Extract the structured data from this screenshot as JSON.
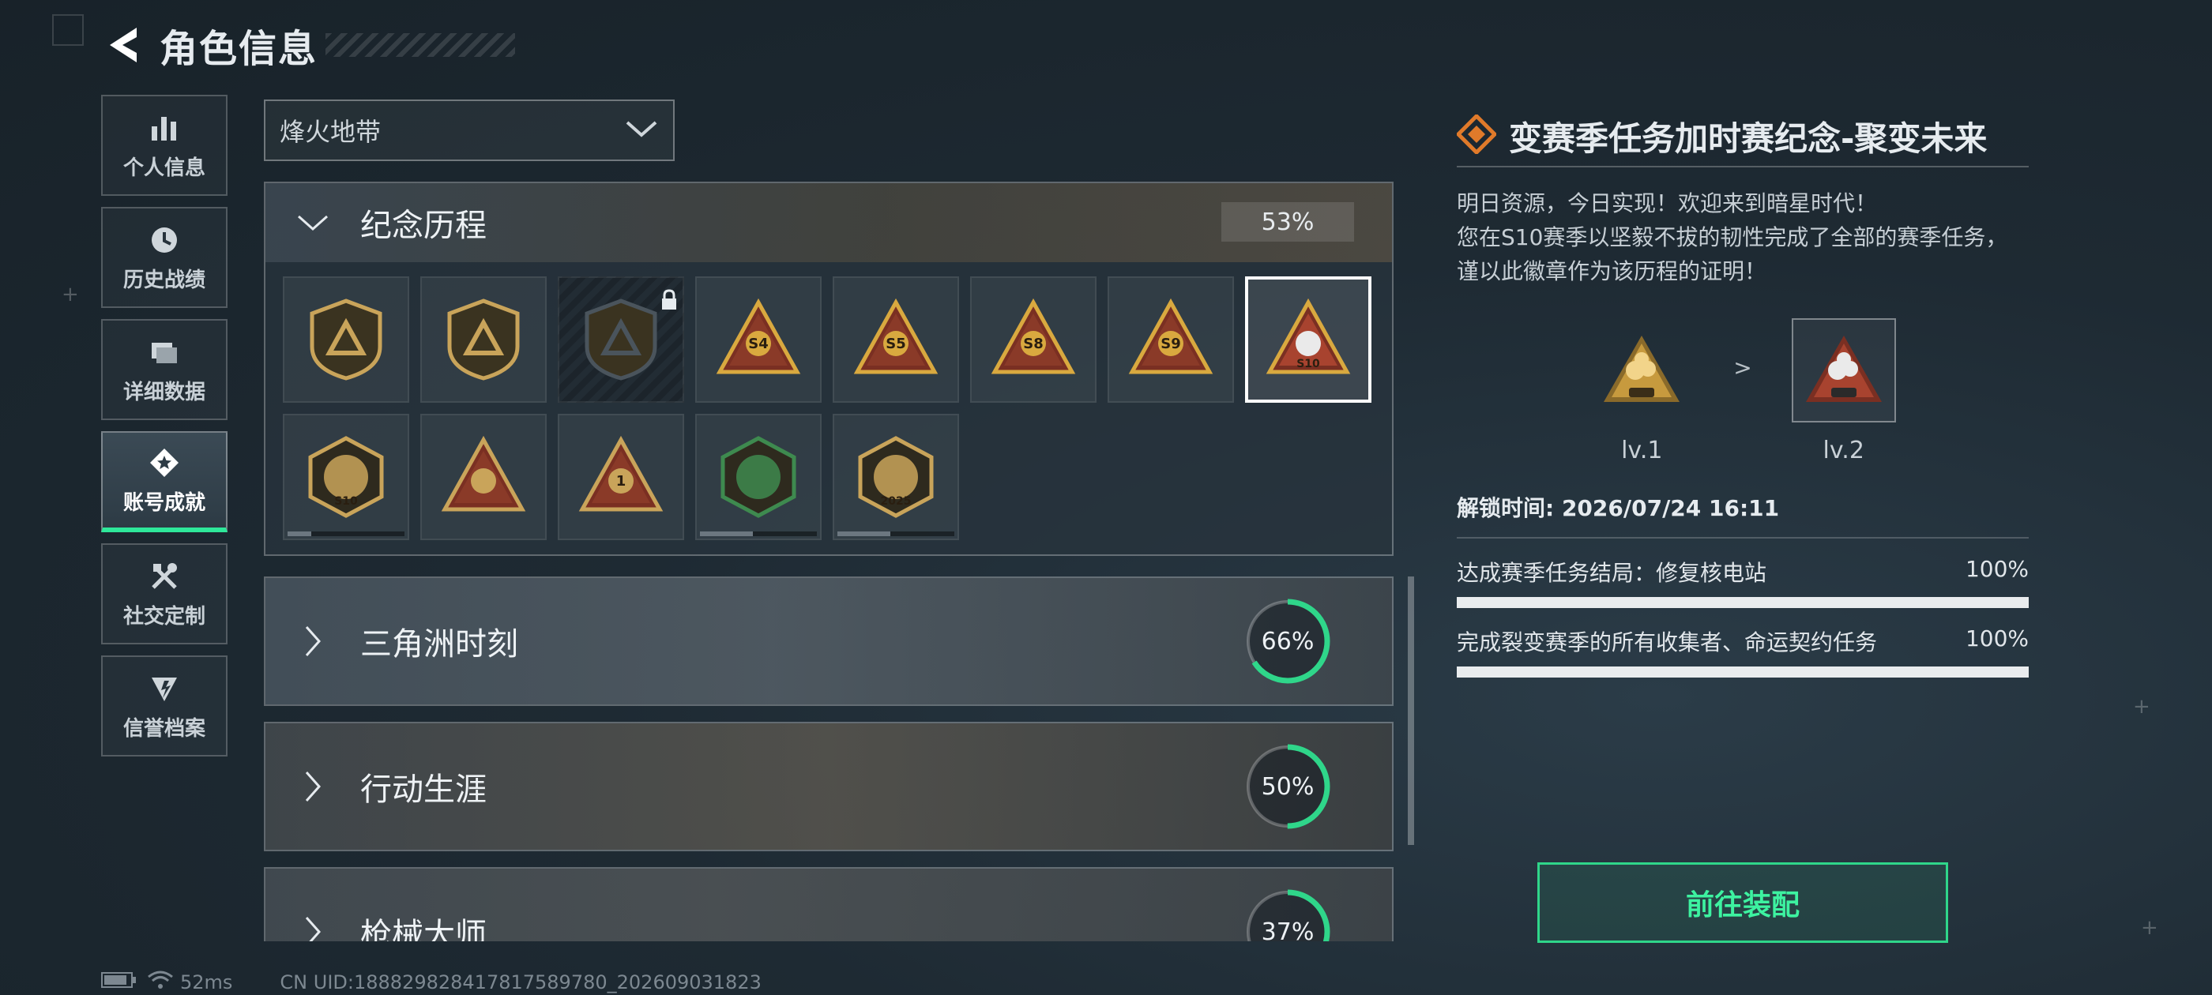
{
  "header": {
    "title": "角色信息"
  },
  "sidebar": {
    "items": [
      {
        "label": "个人信息",
        "icon": "bar-chart-icon"
      },
      {
        "label": "历史战绩",
        "icon": "clock-icon"
      },
      {
        "label": "详细数据",
        "icon": "folder-icon"
      },
      {
        "label": "账号成就",
        "icon": "achievement-star-icon",
        "active": true
      },
      {
        "label": "社交定制",
        "icon": "tools-icon"
      },
      {
        "label": "信誉档案",
        "icon": "shield-badge-icon"
      }
    ]
  },
  "mode_select": {
    "value": "烽火地带"
  },
  "categories": [
    {
      "name": "纪念历程",
      "percent": "53%",
      "expanded": true
    },
    {
      "name": "三角洲时刻",
      "percent": "66%",
      "fill": 0.66
    },
    {
      "name": "行动生涯",
      "percent": "50%",
      "fill": 0.5
    },
    {
      "name": "枪械大师",
      "percent": "37%",
      "fill": 0.37
    }
  ],
  "badges": [
    {
      "name": "triangle-emblem",
      "color": "#c9a45a"
    },
    {
      "name": "helicopter-emblem",
      "color": "#c9a45a"
    },
    {
      "name": "locked-emblem",
      "color": "#4a545c",
      "locked": true
    },
    {
      "name": "s4-emblem",
      "color": "#d9a93f",
      "text": "S4"
    },
    {
      "name": "s5-emblem",
      "color": "#d9a93f",
      "text": "S5"
    },
    {
      "name": "s8-emblem",
      "color": "#d9a93f",
      "text": "S8"
    },
    {
      "name": "s9-emblem",
      "color": "#d9a93f",
      "text": "S9"
    },
    {
      "name": "s10-emblem",
      "color": "#d9a93f",
      "text": "S10",
      "selected": true
    },
    {
      "name": "s10-shield-emblem",
      "color": "#c9a45a",
      "text": "S10",
      "progress": 0.2
    },
    {
      "name": "wings-emblem",
      "color": "#c9a45a"
    },
    {
      "name": "number-one-emblem",
      "color": "#c9a45a",
      "text": "1"
    },
    {
      "name": "delta-force-green-emblem",
      "color": "#3e8a4f",
      "progress": 0.45
    },
    {
      "name": "delta-force-2025-emblem",
      "color": "#c9a45a",
      "text": "2025",
      "progress": 0.45
    }
  ],
  "detail": {
    "title": "变赛季任务加时赛纪念-聚变未来",
    "desc_lines": [
      "明日资源，今日实现！欢迎来到暗星时代！",
      "您在S10赛季以坚毅不拔的韧性完成了全部的赛季任务，",
      "谨以此徽章作为该历程的证明！"
    ],
    "levels": [
      {
        "label": "lv.1"
      },
      {
        "label": "lv.2"
      }
    ],
    "arrow": ">",
    "unlock_time": "解锁时间: 2026/07/24 16:11",
    "tasks": [
      {
        "label": "达成赛季任务结局：修复核电站",
        "value": "100%",
        "fill": 1.0
      },
      {
        "label": "完成裂变赛季的所有收集者、命运契约任务",
        "value": "100%",
        "fill": 1.0
      }
    ],
    "equip_label": "前往装配"
  },
  "status": {
    "ping": "52ms",
    "uid": "CN UID:188829828417817589780_202609031823"
  },
  "colors": {
    "accent": "#2ee89a",
    "gold": "#d9a93f",
    "ring": "#2fd68a",
    "diamond": "#e07a2a"
  }
}
